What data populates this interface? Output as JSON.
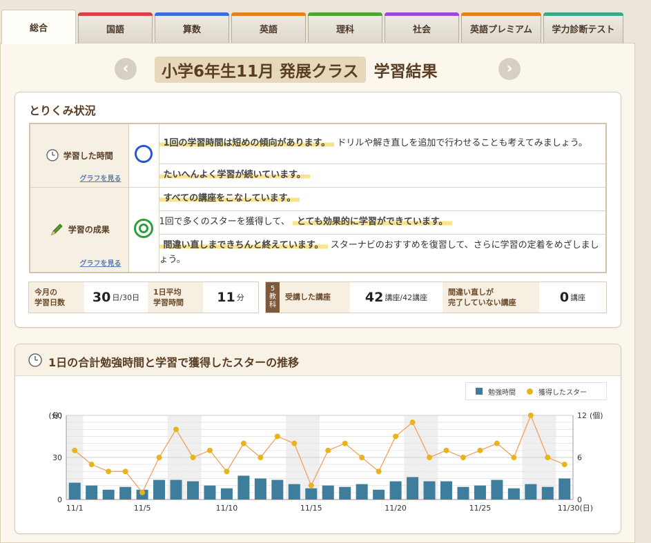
{
  "tabs": [
    {
      "label": "総合",
      "color": "",
      "active": true
    },
    {
      "label": "国語",
      "color": "#d9404a",
      "active": false
    },
    {
      "label": "算数",
      "color": "#3d6fd8",
      "active": false
    },
    {
      "label": "英語",
      "color": "#e8801a",
      "active": false
    },
    {
      "label": "理科",
      "color": "#4da334",
      "active": false
    },
    {
      "label": "社会",
      "color": "#9b4ad8",
      "active": false
    },
    {
      "label": "英語プレミアム",
      "color": "#e8801a",
      "active": false
    },
    {
      "label": "学力診断テスト",
      "color": "#3aa888",
      "active": false
    }
  ],
  "header": {
    "title_highlight": "小学6年生11月 発展クラス",
    "title_rest": "学習結果",
    "prev_arrow": "‹",
    "next_arrow": "›"
  },
  "status_panel": {
    "title": "とりくみ状況",
    "time": {
      "label": "学習した時間",
      "graph_link": "グラフを見る",
      "mark": "circle",
      "msg1_hl": "1回の学習時間は短めの傾向があります。",
      "msg1_rest": "ドリルや解き直しを追加で行わせることも考えてみましょう。",
      "msg2_hl": "たいへんよく学習が続いています。"
    },
    "result": {
      "label": "学習の成果",
      "graph_link": "グラフを見る",
      "mark": "double-circle",
      "msg1_hl": "すべての講座をこなしています。",
      "msg2_pre": "1回で多くのスターを獲得して、",
      "msg2_hl": "とても効果的に学習ができています。",
      "msg3_hl": "間違い直しまできちんと終えています。",
      "msg3_rest": "スターナビのおすすめを復習して、さらに学習の定着をめざしましょう。"
    },
    "stats": {
      "days_label_1": "今月の",
      "days_label_2": "学習日数",
      "days_value": "30",
      "days_unit": "日/30日",
      "avg_label_1": "1日平均",
      "avg_label_2": "学習時間",
      "avg_value": "11",
      "avg_unit": "分",
      "subjects_badge_1": "5",
      "subjects_badge_2": "教",
      "subjects_badge_3": "科",
      "courses_label": "受講した講座",
      "courses_value": "42",
      "courses_unit": "講座/42講座",
      "uncorrected_label_1": "間違い直しが",
      "uncorrected_label_2": "完了していない講座",
      "uncorrected_value": "0",
      "uncorrected_unit": "講座"
    }
  },
  "chart_panel": {
    "title": "1日の合計勉強時間と学習で獲得したスターの推移",
    "legend_bar": "勉強時間",
    "legend_dot": "獲得したスター"
  },
  "chart_data": {
    "type": "bar",
    "left_axis_label": "(分)",
    "right_axis_label": "(個)",
    "ylim_left": [
      0,
      60
    ],
    "ylim_right": [
      0,
      12
    ],
    "yticks_left": [
      "0",
      "30",
      "60"
    ],
    "yticks_right": [
      "0",
      "6",
      "12"
    ],
    "x_tick_labels": [
      {
        "day": 1,
        "label": "11/1"
      },
      {
        "day": 5,
        "label": "11/5"
      },
      {
        "day": 10,
        "label": "11/10"
      },
      {
        "day": 15,
        "label": "11/15"
      },
      {
        "day": 20,
        "label": "11/20"
      },
      {
        "day": 25,
        "label": "11/25"
      },
      {
        "day": 30,
        "label": "11/30(日)"
      }
    ],
    "weekend_days": [
      1,
      7,
      8,
      14,
      15,
      21,
      22,
      28,
      29
    ],
    "bar_color": "#3e7e9c",
    "line_color": "#f0a060",
    "dot_color": "#e7b51b",
    "series": [
      {
        "name": "勉強時間",
        "type": "bar",
        "values": [
          12,
          10,
          7,
          9,
          7,
          14,
          14,
          13,
          10,
          8,
          17,
          15,
          14,
          11,
          8,
          10,
          9,
          11,
          7,
          13,
          16,
          13,
          13,
          9,
          10,
          14,
          8,
          11,
          9,
          15
        ]
      },
      {
        "name": "獲得したスター",
        "type": "line",
        "values": [
          7,
          5,
          4,
          4,
          1,
          6,
          10,
          6,
          7,
          4,
          8,
          6,
          9,
          8,
          2,
          7,
          8,
          6,
          4,
          9,
          11,
          6,
          7,
          6,
          7,
          8,
          6,
          12,
          6,
          5
        ]
      }
    ]
  }
}
